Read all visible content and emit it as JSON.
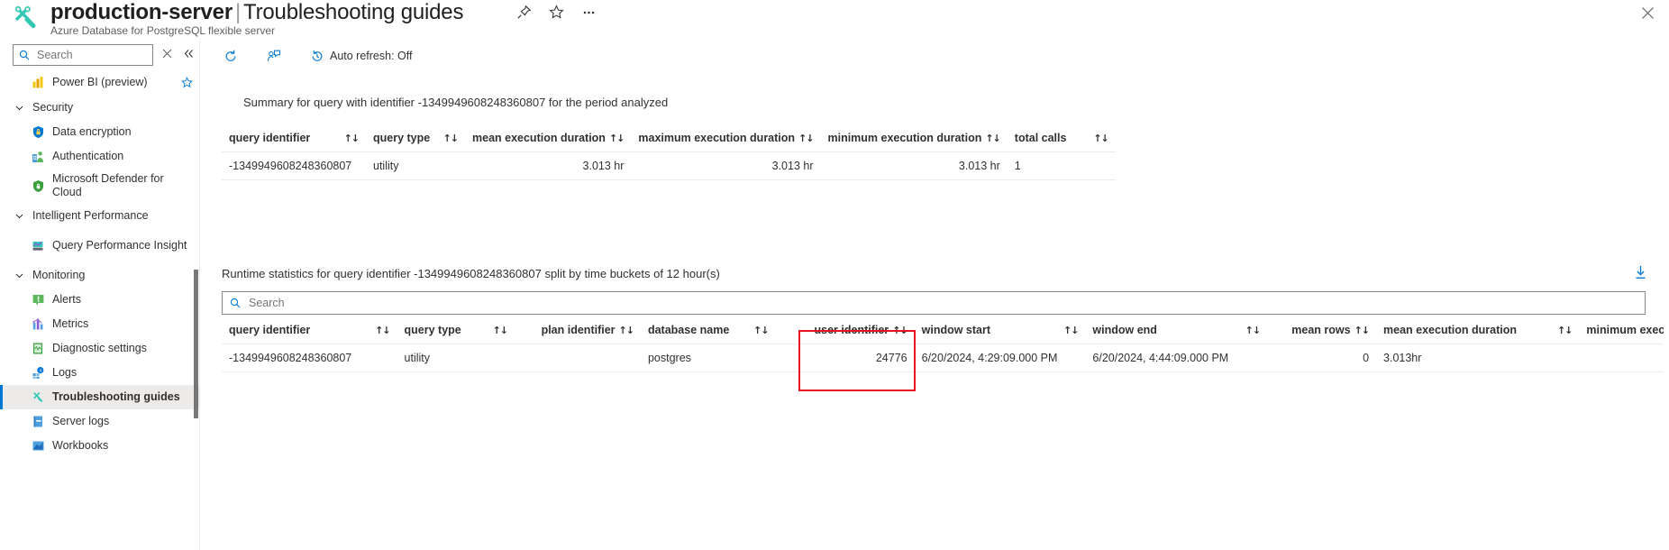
{
  "header": {
    "title_main": "production-server",
    "separator": "|",
    "title_sub": "Troubleshooting guides",
    "subtitle": "Azure Database for PostgreSQL flexible server",
    "pin_icon": "pin-icon",
    "star_icon": "star-icon",
    "more_icon": "ellipsis-icon",
    "close_icon": "close-icon",
    "resource_icon": "troubleshooting-guides-icon"
  },
  "sidebar": {
    "search": {
      "placeholder": "Search",
      "value": "",
      "icon": "search-icon"
    },
    "clear_icon": "close-icon",
    "collapse_icon": "double-chevron-left-icon",
    "items": [
      {
        "label": "Power BI (preview)",
        "type": "item",
        "icon": "power-bi-icon",
        "favorite": "star-outline-icon",
        "selected": false
      },
      {
        "label": "Security",
        "type": "group",
        "icon": "chevron-down-icon"
      },
      {
        "label": "Data encryption",
        "type": "item",
        "icon": "key-shield-icon",
        "selected": false
      },
      {
        "label": "Authentication",
        "type": "item",
        "icon": "authentication-icon",
        "selected": false
      },
      {
        "label": "Microsoft Defender for Cloud",
        "type": "item",
        "icon": "defender-shield-icon",
        "selected": false,
        "two_line": true
      },
      {
        "label": "Intelligent Performance",
        "type": "group",
        "icon": "chevron-down-icon"
      },
      {
        "label": "Query Performance Insight",
        "type": "item",
        "icon": "query-performance-icon",
        "selected": false,
        "two_line": true
      },
      {
        "label": "Monitoring",
        "type": "group",
        "icon": "chevron-down-icon"
      },
      {
        "label": "Alerts",
        "type": "item",
        "icon": "alerts-icon",
        "selected": false
      },
      {
        "label": "Metrics",
        "type": "item",
        "icon": "metrics-icon",
        "selected": false
      },
      {
        "label": "Diagnostic settings",
        "type": "item",
        "icon": "diagnostic-settings-icon",
        "selected": false
      },
      {
        "label": "Logs",
        "type": "item",
        "icon": "logs-icon",
        "selected": false
      },
      {
        "label": "Troubleshooting guides",
        "type": "item",
        "icon": "troubleshooting-guides-icon",
        "selected": true
      },
      {
        "label": "Server logs",
        "type": "item",
        "icon": "server-logs-icon",
        "selected": false
      },
      {
        "label": "Workbooks",
        "type": "item",
        "icon": "workbooks-icon",
        "selected": false
      }
    ]
  },
  "commandbar": {
    "refresh": {
      "label": "",
      "icon": "refresh-icon"
    },
    "feedback": {
      "label": "",
      "icon": "feedback-person-icon"
    },
    "auto_refresh": {
      "label": "Auto refresh: Off",
      "icon": "clock-history-icon"
    }
  },
  "summary_table": {
    "title": "Summary for query with identifier -1349949608248360807 for the period analyzed",
    "columns": [
      {
        "label": "query identifier",
        "sort": "↑↓",
        "align": "left",
        "spread": true
      },
      {
        "label": "query type",
        "sort": "↑↓",
        "align": "left",
        "spread": true
      },
      {
        "label": "mean execution duration",
        "sort": "↑↓",
        "align": "right",
        "spread": false
      },
      {
        "label": "maximum execution duration",
        "sort": "↑↓",
        "align": "right",
        "spread": false
      },
      {
        "label": "minimum execution duration",
        "sort": "↑↓",
        "align": "right",
        "spread": false
      },
      {
        "label": "total calls",
        "sort": "↑↓",
        "align": "left",
        "spread": true
      }
    ],
    "rows": [
      {
        "query_identifier": "-1349949608248360807",
        "query_type": "utility",
        "mean_execution_duration": "3.013 hr",
        "maximum_execution_duration": "3.013 hr",
        "minimum_execution_duration": "3.013 hr",
        "total_calls": "1"
      }
    ]
  },
  "runtime_table": {
    "title": "Runtime statistics for query identifier -1349949608248360807 split by time buckets of 12 hour(s)",
    "download_icon": "download-icon",
    "search": {
      "placeholder": "Search",
      "value": "",
      "icon": "search-icon"
    },
    "columns": [
      {
        "label": "query identifier",
        "sort": "↑↓",
        "align": "left",
        "spread": true
      },
      {
        "label": "query type",
        "sort": "↑↓",
        "align": "left",
        "spread": true
      },
      {
        "label": "plan identifier",
        "sort": "↑↓",
        "align": "right",
        "spread": false
      },
      {
        "label": "database name",
        "sort": "↑↓",
        "align": "left",
        "spread": true
      },
      {
        "label": "user identifier",
        "sort": "↑↓",
        "align": "right",
        "spread": false
      },
      {
        "label": "window start",
        "sort": "↑↓",
        "align": "left",
        "spread": true
      },
      {
        "label": "window end",
        "sort": "↑↓",
        "align": "left",
        "spread": true
      },
      {
        "label": "mean rows",
        "sort": "↑↓",
        "align": "right",
        "spread": false
      },
      {
        "label": "mean execution duration",
        "sort": "↑↓",
        "align": "left",
        "spread": true
      },
      {
        "label": "minimum execution",
        "sort": "",
        "align": "left",
        "spread": false
      }
    ],
    "rows": [
      {
        "query_identifier": "-1349949608248360807",
        "query_type": "utility",
        "plan_identifier": "",
        "database_name": "postgres",
        "user_identifier": "24776",
        "window_start": "6/20/2024, 4:29:09.000 PM",
        "window_end": "6/20/2024, 4:44:09.000 PM",
        "mean_rows": "0",
        "mean_execution_duration": "3.013hr",
        "minimum_execution": ""
      }
    ],
    "highlight": {
      "name": "user-identifier-highlight",
      "color": "#e81123"
    }
  }
}
